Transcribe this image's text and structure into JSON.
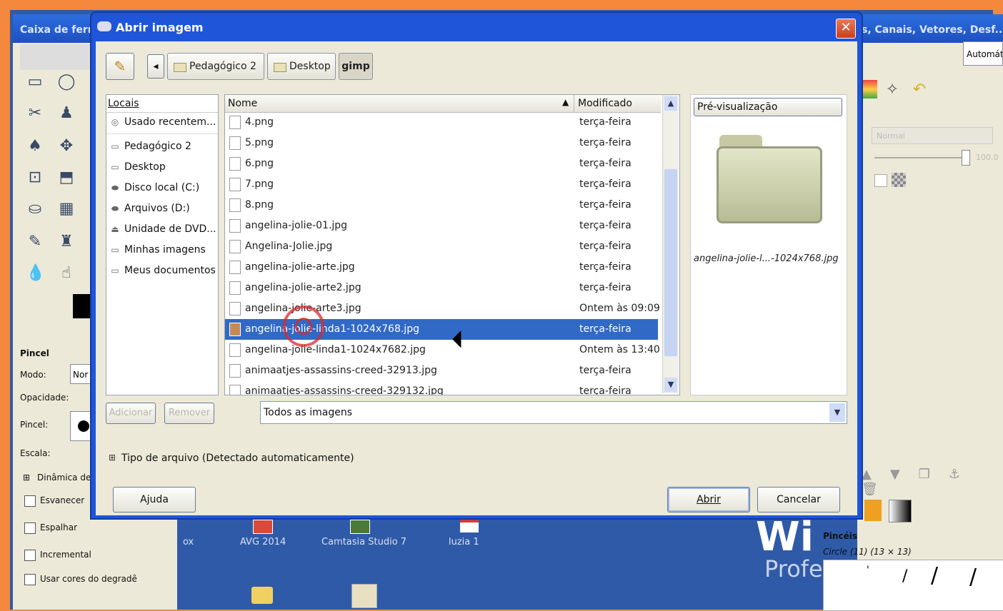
{
  "toolbox": {
    "title": "Caixa de ferr",
    "brush_section": "Pincel",
    "mode_label": "Modo:",
    "mode_value": "Nor",
    "opacity_label": "Opacidade:",
    "brush_label": "Pincel:",
    "scale_label": "Escala:",
    "dynamics_label": "Dinâmica de",
    "options": [
      "Esvanecer",
      "Espalhar",
      "Incremental",
      "Usar cores do degradê"
    ]
  },
  "dock": {
    "title": "s, Canais, Vetores, Desf...",
    "mode_dropdown": "Automáti",
    "layer_mode": "Normal",
    "opacity_value": "100,0",
    "brushes_title": "Pincéis",
    "brush_name": "Circle (11) (13 × 13)"
  },
  "desktop": {
    "icons": [
      {
        "label": "ox"
      },
      {
        "label": "AVG 2014"
      },
      {
        "label": "Camtasia Studio 7"
      },
      {
        "label": "luzia 1"
      }
    ],
    "brand_big": "Wi",
    "brand_small": "Profe"
  },
  "dialog": {
    "title": "Abrir imagem",
    "path": [
      "Pedagógico 2",
      "Desktop",
      "gimp"
    ],
    "places_header": "Locais",
    "places": [
      {
        "label": "Usado recentem...",
        "icon": "recent-icon"
      },
      {
        "label": "Pedagógico 2",
        "icon": "folder-icon"
      },
      {
        "label": "Desktop",
        "icon": "folder-icon"
      },
      {
        "label": "Disco local (C:)",
        "icon": "drive-icon"
      },
      {
        "label": "Arquivos (D:)",
        "icon": "drive-icon"
      },
      {
        "label": "Unidade de DVD...",
        "icon": "dvd-icon"
      },
      {
        "label": "Minhas imagens",
        "icon": "folder-icon"
      },
      {
        "label": "Meus documentos",
        "icon": "folder-icon"
      }
    ],
    "columns": {
      "name": "Nome",
      "modified": "Modificado"
    },
    "files": [
      {
        "name": "4.png",
        "modified": "terça-feira"
      },
      {
        "name": "5.png",
        "modified": "terça-feira"
      },
      {
        "name": "6.png",
        "modified": "terça-feira"
      },
      {
        "name": "7.png",
        "modified": "terça-feira"
      },
      {
        "name": "8.png",
        "modified": "terça-feira"
      },
      {
        "name": "angelina-jolie-01.jpg",
        "modified": "terça-feira"
      },
      {
        "name": "Angelina-Jolie.jpg",
        "modified": "terça-feira"
      },
      {
        "name": "angelina-jolie-arte.jpg",
        "modified": "terça-feira"
      },
      {
        "name": "angelina-jolie-arte2.jpg",
        "modified": "terça-feira"
      },
      {
        "name": "angelina-jolie-arte3.jpg",
        "modified": "Ontem às 09:09"
      },
      {
        "name": "angelina-jolie-linda1-1024x768.jpg",
        "modified": "terça-feira"
      },
      {
        "name": "angelina-jolie-linda1-1024x7682.jpg",
        "modified": "Ontem às 13:40"
      },
      {
        "name": "animaatjes-assassins-creed-32913.jpg",
        "modified": "terça-feira"
      },
      {
        "name": "animaatjes-assassins-creed-329132.jpg",
        "modified": "terça-feira"
      }
    ],
    "selected_index": 10,
    "preview_header": "Pré-visualização",
    "preview_caption": "angelina-jolie-l...-1024x768.jpg",
    "add_button": "Adicionar",
    "remove_button": "Remover",
    "filter_value": "Todos as imagens",
    "file_type_label": "Tipo de arquivo (Detectado automaticamente)",
    "help_button": "Ajuda",
    "open_button": "Abrir",
    "cancel_button": "Cancelar"
  }
}
